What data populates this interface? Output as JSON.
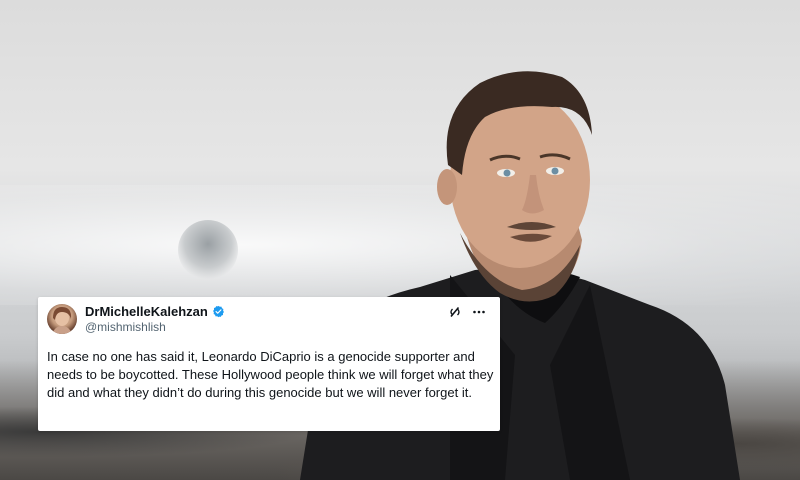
{
  "tweet": {
    "display_name": "DrMichelleKalehzan",
    "handle": "@mishmishlish",
    "verified": true,
    "text": "In case no one has said it, Leonardo DiCaprio is a genocide supporter and needs to be boycotted. These Hollywood people think we will forget what they did and what they didn’t do during this genocide but we will never forget it.",
    "icons": [
      "grok-icon",
      "more-icon"
    ]
  },
  "colors": {
    "verified_badge": "#1d9bf0",
    "tweet_bg": "#ffffff",
    "text": "#0f1419",
    "muted": "#536471",
    "suit": "#1d1d1f"
  }
}
